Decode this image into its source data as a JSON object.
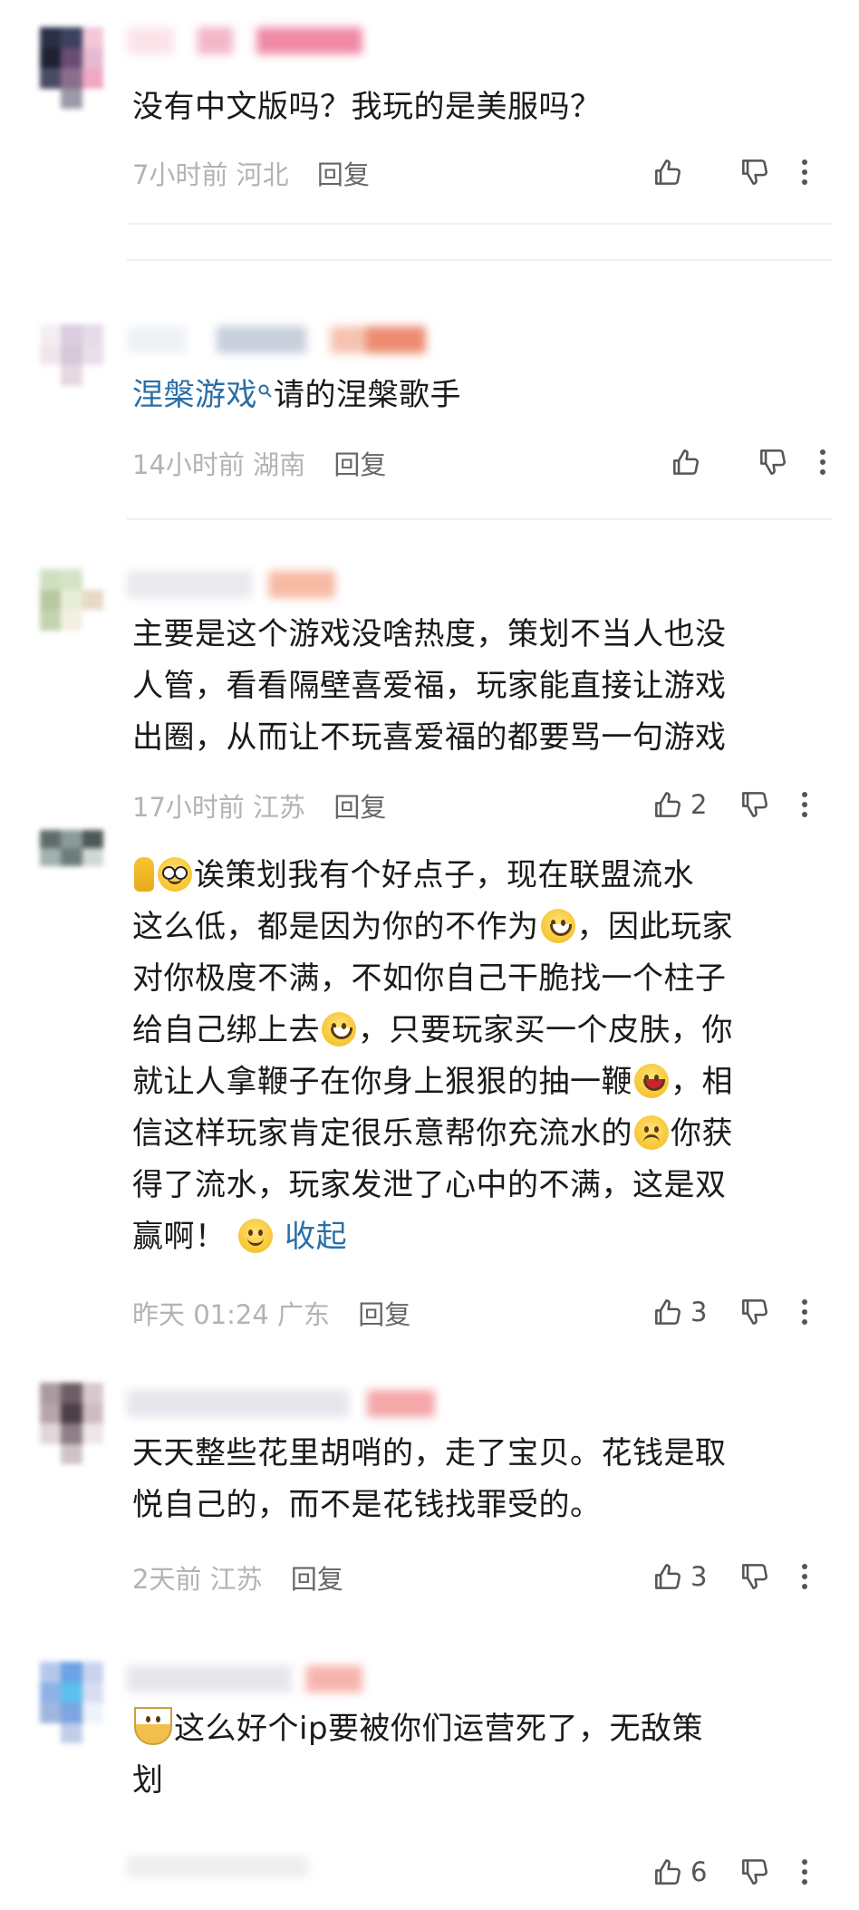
{
  "comments": [
    {
      "text": "没有中文版吗？我玩的是美服吗？",
      "time": "7小时前",
      "location": "河北",
      "reply": "回复",
      "likes": ""
    },
    {
      "link": "涅槃游戏",
      "text_after": "请的涅槃歌手",
      "time": "14小时前",
      "location": "湖南",
      "reply": "回复",
      "likes": ""
    },
    {
      "lines": [
        "主要是这个游戏没啥热度，策划不当人也没",
        "人管，看看隔壁喜爱福，玩家能直接让游戏",
        "出圈，从而让不玩喜爱福的都要骂一句游戏"
      ],
      "time": "17小时前",
      "location": "江苏",
      "reply": "回复",
      "likes": "2"
    },
    {
      "seg1": "诶策划我有个好点子，现在联盟流水",
      "seg2": "这么低，都是因为你的不作为",
      "seg3": "，因此玩家",
      "seg4": "对你极度不满，不如你自己干脆找一个柱子",
      "seg5": "给自己绑上去",
      "seg6": "，只要玩家买一个皮肤，你",
      "seg7": "就让人拿鞭子在你身上狠狠的抽一鞭",
      "seg8": "，相",
      "seg9": "信这样玩家肯定很乐意帮你充流水的",
      "seg10": "你获",
      "seg11": "得了流水，玩家发泄了心中的不满，这是双",
      "seg12": "赢啊！",
      "collapse": "收起",
      "time": "昨天 01:24",
      "location": "广东",
      "reply": "回复",
      "likes": "3"
    },
    {
      "lines": [
        "天天整些花里胡哨的，走了宝贝。花钱是取",
        "悦自己的，而不是花钱找罪受的。"
      ],
      "time": "2天前",
      "location": "江苏",
      "reply": "回复",
      "likes": "3"
    },
    {
      "seg1": "这么好个ip要被你们运营死了，无敌策",
      "seg2": "划",
      "likes": "6"
    }
  ],
  "icons": {
    "like": "thumbs-up-icon",
    "dislike": "thumbs-down-icon",
    "more": "more-vertical-icon"
  }
}
